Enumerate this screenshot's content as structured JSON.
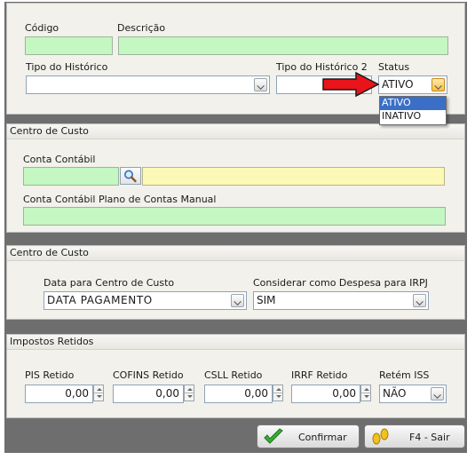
{
  "header": {
    "codigo_label": "Código",
    "descricao_label": "Descrição",
    "tipo_historico_label": "Tipo do Histórico",
    "tipo_historico_2_label": "Tipo do Histórico 2",
    "status_label": "Status",
    "codigo_value": "",
    "descricao_value": "",
    "tipo_historico_value": "",
    "tipo_historico_2_value": "",
    "status_value": "ATIVO",
    "status_options": [
      "ATIVO",
      "INATIVO"
    ]
  },
  "centro_custo_1": {
    "title": "Centro de Custo",
    "conta_contabil_label": "Conta Contábil",
    "conta_contabil_value": "",
    "conta_contabil_desc": "",
    "plano_manual_label": "Conta Contábil Plano de Contas Manual",
    "plano_manual_value": ""
  },
  "centro_custo_2": {
    "title": "Centro de Custo",
    "data_label": "Data para Centro de Custo",
    "data_value": "DATA PAGAMENTO",
    "despesa_label": "Considerar como Despesa para IRPJ",
    "despesa_value": "SIM"
  },
  "impostos": {
    "title": "Impostos Retidos",
    "pis_label": "PIS Retido",
    "pis_value": "0,00",
    "cofins_label": "COFINS Retido",
    "cofins_value": "0,00",
    "csll_label": "CSLL Retido",
    "csll_value": "0,00",
    "irrf_label": "IRRF Retido",
    "irrf_value": "0,00",
    "retem_label": "Retém ISS",
    "retem_value": "NÃO"
  },
  "footer": {
    "confirmar_label": "Confirmar",
    "sair_label": "F4 - Sair"
  },
  "colors": {
    "required_field": "#c4f7c1",
    "readonly_field": "#fcf8b6",
    "selection": "#3b6fc7",
    "arrow": "#e8141a"
  },
  "icons": {
    "search": "magnifier-icon",
    "confirm": "checkmark-icon",
    "exit": "footprints-icon",
    "pointer": "red-arrow-icon"
  }
}
